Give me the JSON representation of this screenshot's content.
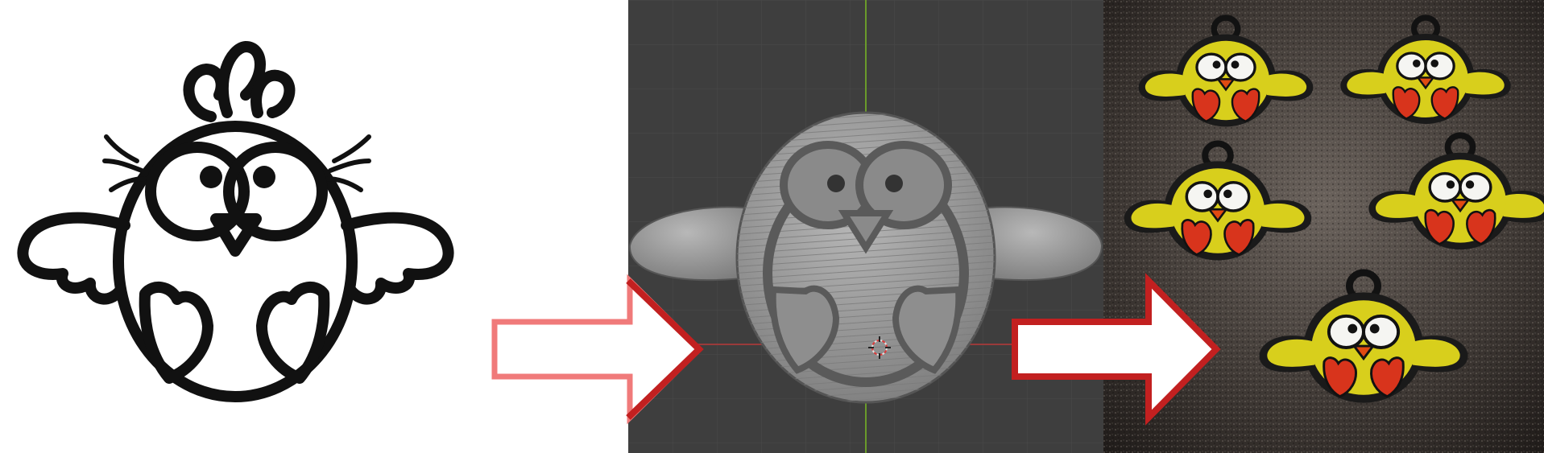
{
  "composition": {
    "panels": [
      "line-drawing",
      "3d-model-viewport",
      "printed-keychains-photo"
    ],
    "arrow_count": 2
  },
  "colors": {
    "ink": "#111111",
    "viewport_bg": "#3e3e3e",
    "grid_line": "#4a4a4a",
    "axis_green": "#6a9a2a",
    "axis_red": "#9a3a3a",
    "mesh_body": "#9e9e9e",
    "mesh_shadow": "#6a6a6a",
    "arrow_fill": "#ffffff",
    "arrow_outline_light": "#f07a7a",
    "arrow_outline_dark": "#c22020",
    "chick_yellow": "#d8cf1c",
    "chick_red": "#d8341c",
    "chick_beak": "#e04a12",
    "photo_surface": "#2a2624"
  },
  "icons": {
    "drawing": "chick-line-drawing-icon",
    "model": "chick-3d-mesh-icon",
    "keychain": "chick-keychain-icon",
    "arrow": "right-arrow-icon"
  }
}
